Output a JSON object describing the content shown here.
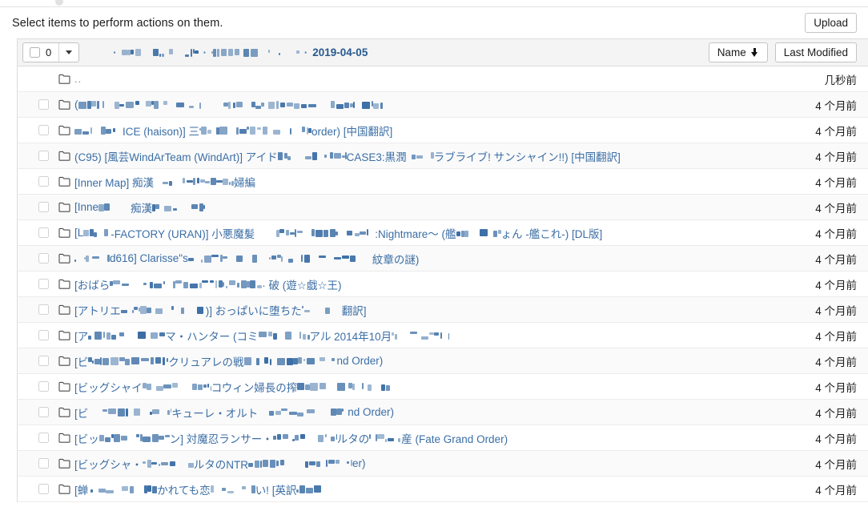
{
  "header": {
    "note": "Select items to perform actions on them.",
    "upload_label": "Upload"
  },
  "toolbar": {
    "selected_count": "0",
    "checkbox_icon": "checkbox-icon",
    "caret_icon": "chevron-down-icon",
    "sort_name_label": "Name",
    "sort_name_arrow_icon": "arrow-down-icon",
    "sort_modified_label": "Last Modified",
    "breadcrumb": {
      "separator": "·",
      "segments": [
        {
          "type": "redacted",
          "width": 18
        },
        {
          "type": "redacted",
          "width": 96
        },
        {
          "type": "redacted",
          "width": 110
        },
        {
          "type": "text",
          "label": "2019-04-05"
        }
      ]
    }
  },
  "columns": {
    "name": "Name",
    "last_modified": "Last Modified"
  },
  "rows": [
    {
      "icon": "folder-icon",
      "name": "..",
      "is_parent": true,
      "checkbox": false,
      "modified": "几秒前"
    },
    {
      "icon": "folder-icon",
      "name": "(",
      "redacted_after": 380,
      "checkbox": true,
      "modified": "4 个月前"
    },
    {
      "icon": "folder-icon",
      "name": "ICE (haison)] 三",
      "prefix_redacted": 60,
      "mid_redacted": 140,
      "suffix": "order) [中国翻訳]",
      "checkbox": true,
      "modified": "4 个月前"
    },
    {
      "icon": "folder-icon",
      "name": "(C95) [風芸WindArTeam (WindArt)] アイド",
      "mid_redacted": 86,
      "suffix": "CASE3:黒潤",
      "suffix2_redacted": 34,
      "suffix2": "ラブライブ! サンシャイン!!) [中国翻訳]",
      "checkbox": true,
      "modified": "4 个月前"
    },
    {
      "icon": "folder-icon",
      "name": "[Inner Map] 痴漢",
      "mid_redacted": 100,
      "suffix": "婦編",
      "checkbox": true,
      "modified": "4 个月前"
    },
    {
      "icon": "folder-icon",
      "name": "[Inne",
      "mid_redacted": 40,
      "suffix": "痴漢",
      "suffix2_redacted": 66,
      "checkbox": true,
      "modified": "4 个月前"
    },
    {
      "icon": "folder-icon",
      "name": "[L",
      "mid_redacted": 34,
      "suffix": "-FACTORY (URAN)] 小悪魔髪",
      "suffix2_redacted": 150,
      "suffix2": ":Nightmare〜 (艦",
      "suffix3_redacted": 56,
      "suffix3": "ょん -艦これ-) [DL版]",
      "checkbox": true,
      "modified": "4 个月前"
    },
    {
      "icon": "folder-icon",
      "name": "",
      "prefix_redacted": 44,
      "suffix": "d616] Clarisse\"s",
      "suffix2_redacted": 230,
      "suffix2": "紋章の謎)",
      "checkbox": true,
      "modified": "4 个月前"
    },
    {
      "icon": "folder-icon",
      "name": "[おばら",
      "mid_redacted": 190,
      "suffix": "· 破 (遊☆戯☆王)",
      "checkbox": true,
      "modified": "4 个月前"
    },
    {
      "icon": "folder-icon",
      "name": "[アトリエ",
      "mid_redacted": 106,
      "suffix": ")] おっぱいに堕ちた",
      "suffix2_redacted": 50,
      "suffix2": "翻訳]",
      "checkbox": true,
      "modified": "4 个月前"
    },
    {
      "icon": "folder-icon",
      "name": "[ア",
      "mid_redacted": 96,
      "suffix": "マ・ハンター (コミ",
      "suffix2_redacted": 64,
      "suffix2": "アル 2014年10月",
      "suffix3_redacted": 72,
      "checkbox": true,
      "modified": "4 个月前"
    },
    {
      "icon": "folder-icon",
      "name": "[ビ",
      "mid_redacted": 100,
      "suffix": "クリュアレの戦",
      "suffix2_redacted": 116,
      "suffix2": "nd Order)",
      "checkbox": true,
      "modified": "4 个月前"
    },
    {
      "icon": "folder-icon",
      "name": "[ビッグシャイ",
      "mid_redacted": 86,
      "suffix": "コウィン婦長の搾",
      "suffix2_redacted": 118,
      "checkbox": true,
      "modified": "4 个月前"
    },
    {
      "icon": "folder-icon",
      "name": "[ビ",
      "mid_redacted": 104,
      "suffix": "キューレ・オルト",
      "suffix2_redacted": 112,
      "suffix2": "nd Order)",
      "checkbox": true,
      "modified": "4 个月前"
    },
    {
      "icon": "folder-icon",
      "name": "[ビッ",
      "mid_redacted": 88,
      "suffix": "ン] 対魔忍ランサー・",
      "suffix2_redacted": 80,
      "suffix2": "ルタの",
      "suffix3_redacted": 40,
      "suffix3": "産 (Fate Grand Order)",
      "checkbox": true,
      "modified": "4 个月前"
    },
    {
      "icon": "folder-icon",
      "name": "[ビッグシャ・",
      "mid_redacted": 64,
      "suffix": "ルタのNTR",
      "suffix2_redacted": 130,
      "suffix2": "er)",
      "checkbox": true,
      "modified": "4 个月前"
    },
    {
      "icon": "folder-icon",
      "name": "[蝉",
      "mid_redacted": 86,
      "suffix": "かれても恋",
      "suffix2_redacted": 56,
      "suffix2": "い! [英訳",
      "suffix3_redacted": 40,
      "checkbox": true,
      "modified": "4 个月前"
    }
  ],
  "colors": {
    "link": "#3b6ea5",
    "redaction": "#3b6ea5",
    "toolbar_bg": "#f4f4f4",
    "row_alt_bg": "#fafafa",
    "border": "#dcdcdc",
    "text": "#1d1d1d"
  }
}
